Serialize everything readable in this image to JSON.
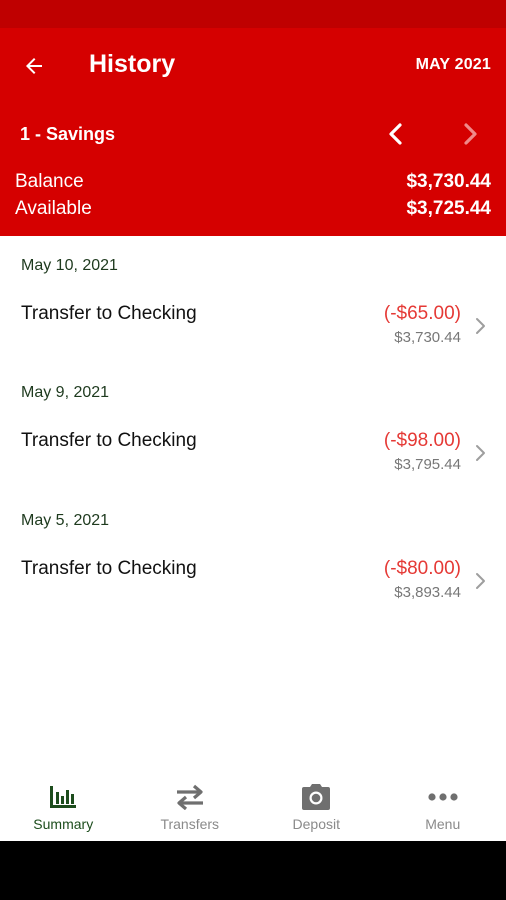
{
  "header": {
    "title": "History",
    "month": "MAY 2021",
    "account_name": "1 - Savings",
    "balance_label": "Balance",
    "balance_value": "$3,730.44",
    "available_label": "Available",
    "available_value": "$3,725.44"
  },
  "transactions": [
    {
      "date": "May 10, 2021",
      "description": "Transfer to Checking",
      "amount": "(-$65.00)",
      "running_balance": "$3,730.44"
    },
    {
      "date": "May 9, 2021",
      "description": "Transfer to Checking",
      "amount": "(-$98.00)",
      "running_balance": "$3,795.44"
    },
    {
      "date": "May 5, 2021",
      "description": "Transfer to Checking",
      "amount": "(-$80.00)",
      "running_balance": "$3,893.44"
    }
  ],
  "nav": {
    "items": [
      {
        "label": "Summary",
        "icon": "bar-chart-icon",
        "active": true
      },
      {
        "label": "Transfers",
        "icon": "transfer-arrows-icon",
        "active": false
      },
      {
        "label": "Deposit",
        "icon": "camera-icon",
        "active": false
      },
      {
        "label": "Menu",
        "icon": "more-horizontal-icon",
        "active": false
      }
    ]
  },
  "colors": {
    "header_bg": "#d50000",
    "status_bar_bg": "#bf0000",
    "debit_amount": "#e53935",
    "active_nav": "#1d4d1d",
    "inactive_nav": "#8a8a8a"
  }
}
